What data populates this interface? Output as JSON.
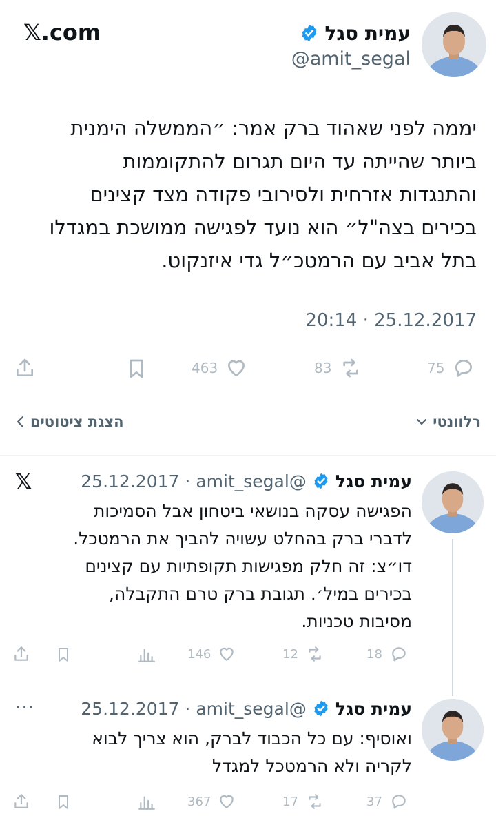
{
  "header": {
    "logo_text": "𝕏.com",
    "display_name": "עמית סגל",
    "handle": "@amit_segal"
  },
  "main_tweet": {
    "lines": [
      "יממה לפני שאהוד ברק אמר: ״הממשלה הימנית",
      "ביותר שהייתה עד היום תגרום להתקוממות",
      "והתנגדות אזרחית ולסירובי פקודה מצד קצינים",
      "בכירים בצה\"ל״ הוא נועד לפגישה ממושכת במגדלו",
      "בתל אביב עם הרמטכ״ל גדי איזנקוט."
    ],
    "timestamp": "20:14 · 25.12.2017",
    "stats": {
      "replies": "75",
      "retweets": "83",
      "likes": "463"
    }
  },
  "sort_bar": {
    "left_label": "הצגת ציטוטים",
    "right_label": "רלוונטי"
  },
  "replies": [
    {
      "display_name": "עמית סגל",
      "handle": "@amit_segal",
      "date": "25.12.2017",
      "lines": [
        "הפגישה עסקה בנושאי ביטחון אבל הסמיכות",
        "לדברי ברק בהחלט עשויה להביך את הרמטכל.",
        "דו״צ: זה חלק מפגישות תקופתיות עם קצינים",
        "בכירים במיל׳. תגובת ברק טרם התקבלה,",
        "מסיבות טכניות."
      ],
      "stats": {
        "replies": "18",
        "retweets": "12",
        "likes": "146"
      }
    },
    {
      "display_name": "עמית סגל",
      "handle": "@amit_segal",
      "date": "25.12.2017",
      "lines": [
        "ואוסיף: עם כל הכבוד לברק, הוא צריך לבוא",
        "לקריה ולא הרמטכל למגדל"
      ],
      "stats": {
        "replies": "37",
        "retweets": "17",
        "likes": "367"
      }
    }
  ],
  "colors": {
    "text": "#0f1419",
    "secondary": "#536471",
    "verified": "#1d9bf0",
    "divider": "#eff3f4",
    "faded_icon": "#b0bac2"
  }
}
